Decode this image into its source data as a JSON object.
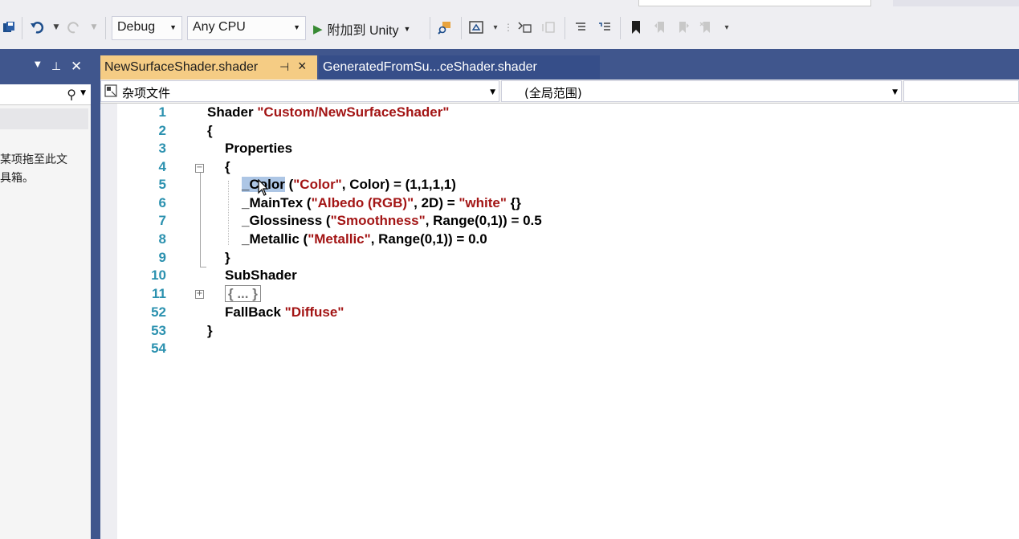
{
  "toolbar": {
    "config": "Debug",
    "platform": "Any CPU",
    "attach_label": "附加到 Unity"
  },
  "left_panel": {
    "message": "某项拖至此文\n具箱。"
  },
  "tabs": [
    {
      "label": "NewSurfaceShader.shader",
      "active": true
    },
    {
      "label": "GeneratedFromSu...ceShader.shader",
      "active": false
    }
  ],
  "navbar": {
    "project": "杂项文件",
    "scope": "(全局范围)"
  },
  "editor": {
    "line_numbers": [
      "1",
      "2",
      "3",
      "4",
      "5",
      "6",
      "7",
      "8",
      "9",
      "10",
      "11",
      "52",
      "53",
      "54"
    ],
    "lines": {
      "l1_kw": "Shader ",
      "l1_str": "\"Custom/NewSurfaceShader\"",
      "l2": "{",
      "l3": "Properties",
      "l4": "{",
      "l5_sel": "_Color",
      "l5_a": " (",
      "l5_str": "\"Color\"",
      "l5_b": ", Color) = (1,1,1,1)",
      "l6_a": "_MainTex (",
      "l6_str": "\"Albedo (RGB)\"",
      "l6_b": ", 2D) = ",
      "l6_str2": "\"white\"",
      "l6_c": " {}",
      "l7_a": "_Glossiness (",
      "l7_str": "\"Smoothness\"",
      "l7_b": ", Range(0,1)) = 0.5",
      "l8_a": "_Metallic (",
      "l8_str": "\"Metallic\"",
      "l8_b": ", Range(0,1)) = 0.0",
      "l9": "}",
      "l10": "SubShader",
      "l11": "{ ... }",
      "l52_kw": "FallBack ",
      "l52_str": "\"Diffuse\"",
      "l53": "}"
    }
  }
}
